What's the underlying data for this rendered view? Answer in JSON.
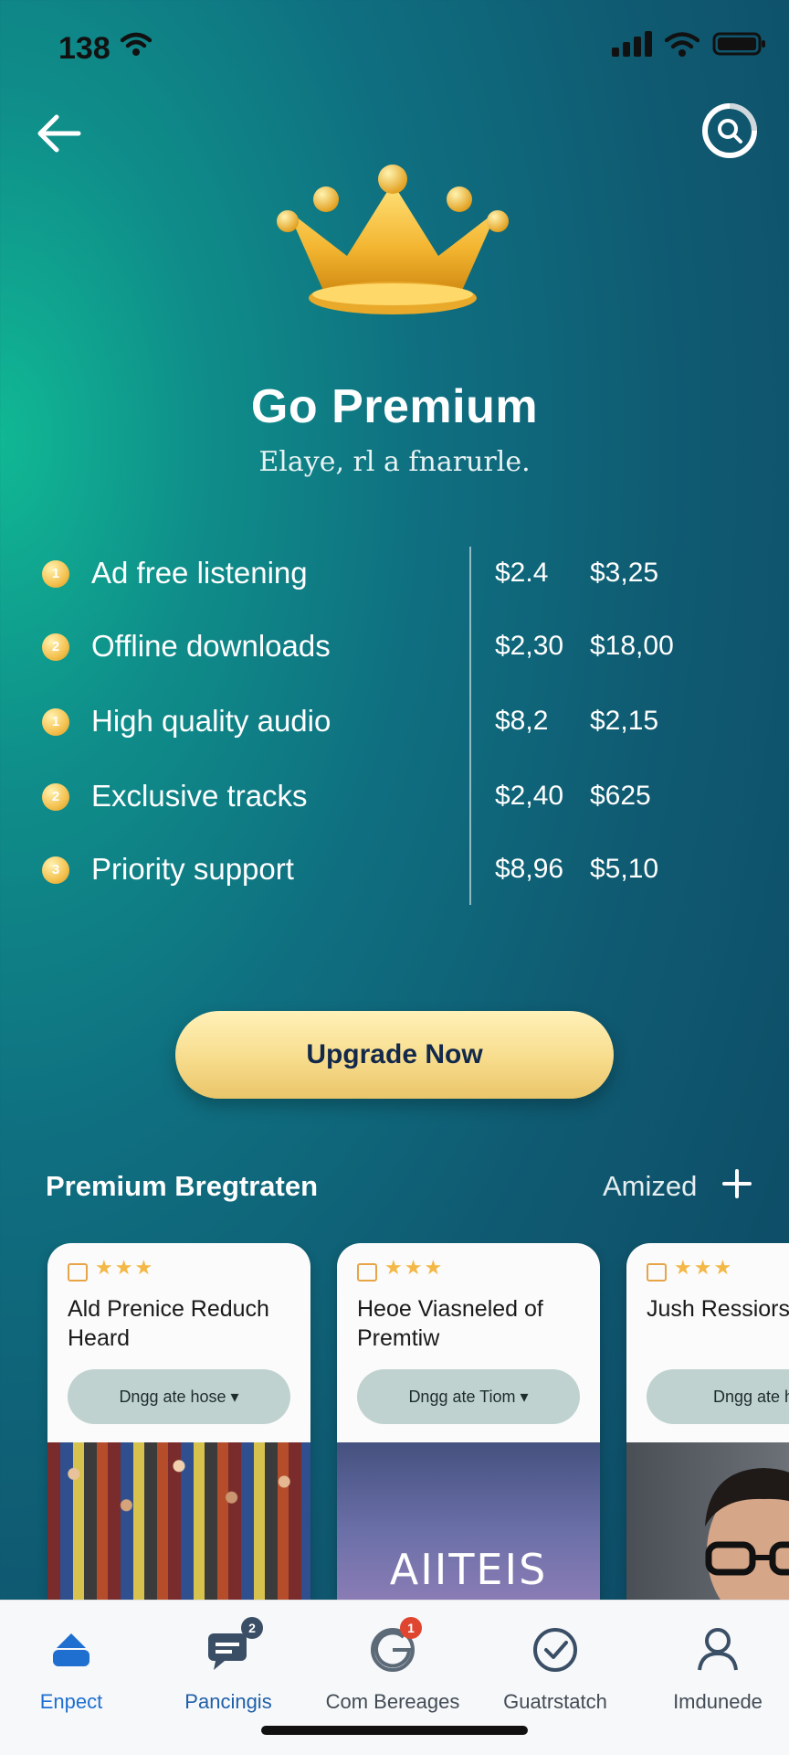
{
  "status_bar": {
    "time": "138"
  },
  "header": {
    "title": "Go Premium",
    "subtitle": "Elaye, rl a fnarurle."
  },
  "features": [
    {
      "num": "1",
      "label": "Ad free listening",
      "price_a": "$2.4",
      "price_b": "$3,25"
    },
    {
      "num": "2",
      "label": "Offline downloads",
      "price_a": "$2,30",
      "price_b": "$18,00"
    },
    {
      "num": "1",
      "label": "High quality audio",
      "price_a": "$8,2",
      "price_b": "$2,15"
    },
    {
      "num": "2",
      "label": "Exclusive tracks",
      "price_a": "$2,40",
      "price_b": "$625"
    },
    {
      "num": "3",
      "label": "Priority support",
      "price_a": "$8,96",
      "price_b": "$5,10"
    }
  ],
  "cta": {
    "label": "Upgrade Now"
  },
  "section": {
    "title": "Premium Bregtraten",
    "action": "Amized"
  },
  "cards": [
    {
      "stars": "★★★",
      "title": "Ald Prenice Reduch Heard",
      "button": "Dngg ate hose ▾",
      "image": "crowd"
    },
    {
      "stars": "★★★",
      "title": "Heoe Viasneled of Premtiw",
      "button": "Dngg ate Tiom ▾",
      "image_text": "AIITEIS"
    },
    {
      "stars": "★★★",
      "title": "Jush Ressiors Riemo",
      "button": "Dngg ate ho",
      "image": "portrait"
    }
  ],
  "tabs": [
    {
      "label": "Enpect",
      "icon": "boat-icon"
    },
    {
      "label": "Pancingis",
      "icon": "chat-icon",
      "badge": "2"
    },
    {
      "label": "Com Bereages",
      "icon": "google-icon",
      "badge": "1"
    },
    {
      "label": "Guatrstatch",
      "icon": "check-icon"
    },
    {
      "label": "Imdunede",
      "icon": "user-icon"
    }
  ],
  "colors": {
    "accent_blue": "#1f6fd1",
    "gold": "#f4c14f",
    "badge_red": "#e0462f"
  }
}
